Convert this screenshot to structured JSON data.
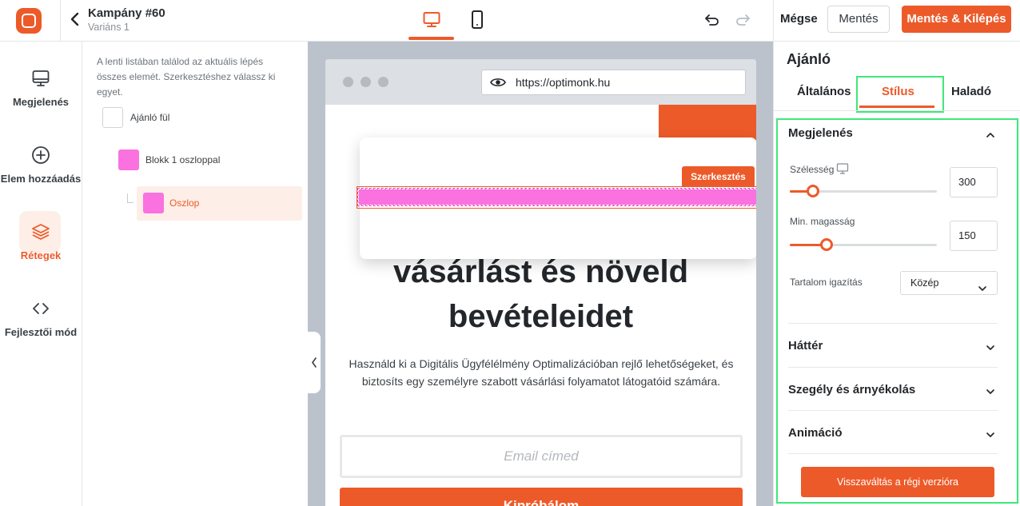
{
  "topbar": {
    "campaign_title": "Kampány #60",
    "variant": "Variáns 1",
    "cancel_label": "Mégse",
    "save_label": "Mentés",
    "save_exit_label": "Mentés & Kilépés"
  },
  "sidebar": {
    "items": [
      {
        "label": "Megjelenés",
        "icon": "monitor-icon"
      },
      {
        "label": "Elem hozzáadás",
        "icon": "plus-circle-icon"
      },
      {
        "label": "Rétegek",
        "icon": "layers-icon",
        "active": true
      },
      {
        "label": "Fejlesztői mód",
        "icon": "code-icon"
      }
    ]
  },
  "layers": {
    "hint": "A lenti listában találod az aktuális lépés összes elemét. Szerkesztéshez válassz ki egyet.",
    "items": [
      {
        "label": "Ajánló fül"
      },
      {
        "label": "Blokk 1 oszloppal"
      },
      {
        "label": "Oszlop"
      }
    ]
  },
  "canvas": {
    "url": "https://optimonk.hu",
    "headline_line1": "vásárlást és növeld",
    "headline_line2": "bevételeidet",
    "paragraph": "Használd ki a Digitális Ügyfélélmény Optimalizációban rejlő lehetőségeket, és biztosíts egy személyre szabott vásárlási folyamatot látogatóid számára.",
    "email_placeholder": "Email címed",
    "submit_label": "Kipróbálom",
    "edit_tag": "Szerkesztés"
  },
  "right_panel": {
    "title": "Ajánló",
    "tabs": [
      "Általános",
      "Stílus",
      "Haladó"
    ],
    "active_tab": "Stílus",
    "section_appearance": "Megjelenés",
    "width_label": "Szélesség",
    "width_value": "300",
    "width_fraction": 0.16,
    "min_height_label": "Min. magasság",
    "min_height_value": "150",
    "min_height_fraction": 0.25,
    "align_label": "Tartalom igazítás",
    "align_value": "Közép",
    "section_background": "Háttér",
    "section_border": "Szegély és árnyékolás",
    "section_animation": "Animáció",
    "legacy_button": "Visszaváltás a régi verzióra"
  },
  "colors": {
    "accent": "#ed5a29",
    "selection_pink": "#fa71e0",
    "highlight_green": "#3ee87a"
  }
}
